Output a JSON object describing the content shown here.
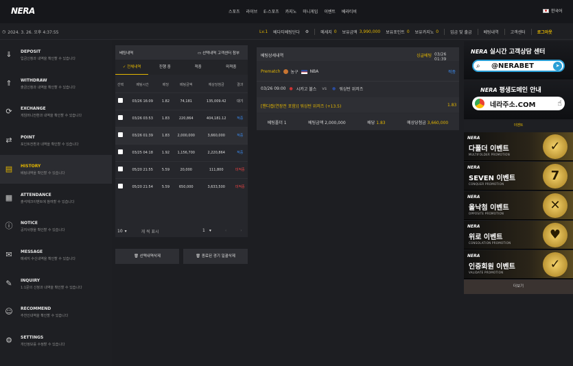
{
  "brand": {
    "logo": "NERA"
  },
  "nav": [
    "스포츠",
    "라이브",
    "E-스포츠",
    "카지노",
    "미니게임",
    "이벤트",
    "베라티비"
  ],
  "lang": "한국어",
  "clock": "2024. 3. 26. 오후 4:37:55",
  "info": {
    "level": "Lv.1",
    "user": "베다티베팅단다",
    "notice_label": "메세지",
    "notice_count": "0",
    "balance_label": "보유금액",
    "balance": "3,990,000",
    "points_label": "보유포인트",
    "points": "0",
    "casino_label": "보유카지노",
    "casino": "0",
    "deposit": "입금 및 출금",
    "history": "베팅내역",
    "cs": "고객센터",
    "logout": "로그아웃"
  },
  "sidebar": [
    {
      "icon": "deposit-icon",
      "glyph": "⇓",
      "title": "DEPOSIT",
      "desc": "입금신청과 내역을 확인할 수 있습니다"
    },
    {
      "icon": "withdraw-icon",
      "glyph": "⇑",
      "title": "WITHDRAW",
      "desc": "출금신청과 내역을 확인할 수 있습니다"
    },
    {
      "icon": "exchange-icon",
      "glyph": "⟳",
      "title": "EXCHANGE",
      "desc": "게임머니전환과 내역을 확인할 수 있습니다"
    },
    {
      "icon": "point-icon",
      "glyph": "⇄",
      "title": "POINT",
      "desc": "포인트전환과 내역을 확인할 수 있습니다"
    },
    {
      "icon": "history-icon",
      "glyph": "▤",
      "title": "HISTORY",
      "desc": "베팅내역을 확인할 수 있습니다"
    },
    {
      "icon": "attendance-icon",
      "glyph": "▦",
      "title": "ATTENDANCE",
      "desc": "출석체크이벤트에 참여할 수 있습니다"
    },
    {
      "icon": "notice-icon",
      "glyph": "ⓘ",
      "title": "NOTICE",
      "desc": "공지사항을 확인할 수 있습니다"
    },
    {
      "icon": "message-icon",
      "glyph": "✉",
      "title": "MESSAGE",
      "desc": "메세지 수신내역을 확인할 수 있습니다"
    },
    {
      "icon": "inquiry-icon",
      "glyph": "✎",
      "title": "INQUIRY",
      "desc": "1:1문의 신청과 내역을 확인할 수 있습니다"
    },
    {
      "icon": "recommend-icon",
      "glyph": "☺",
      "title": "RECOMMEND",
      "desc": "추천인내역을 확인할 수 있습니다"
    },
    {
      "icon": "settings-icon",
      "glyph": "⚙",
      "title": "SETTINGS",
      "desc": "개인정보를 수정할 수 있습니다"
    }
  ],
  "betlist": {
    "title": "베팅내역",
    "attach": "선택내역 고객센터 첨부",
    "tabs": [
      "전체내역",
      "진행 중",
      "적중",
      "미적중"
    ],
    "columns": [
      "선택",
      "베팅시간",
      "배당",
      "베팅금액",
      "예상당첨금",
      "결과"
    ],
    "rows": [
      {
        "time": "03/26 16:09",
        "odds": "1.82",
        "amount": "74,181",
        "win": "135,009.42",
        "result": "대기",
        "cls": "st-gray"
      },
      {
        "time": "03/26 03:53",
        "odds": "1.83",
        "amount": "220,864",
        "win": "404,181.12",
        "result": "적중",
        "cls": "st-blue"
      },
      {
        "time": "03/26 01:39",
        "odds": "1.83",
        "amount": "2,000,000",
        "win": "3,660,000",
        "result": "적중",
        "cls": "st-blue"
      },
      {
        "time": "03/25 04:18",
        "odds": "1.92",
        "amount": "1,156,700",
        "win": "2,220,864",
        "result": "적중",
        "cls": "st-blue"
      },
      {
        "time": "05/20 21:55",
        "odds": "5.59",
        "amount": "20,000",
        "win": "111,800",
        "result": "미적중",
        "cls": "st-red"
      },
      {
        "time": "05/20 21:54",
        "odds": "5.59",
        "amount": "650,000",
        "win": "3,633,500",
        "result": "미적중",
        "cls": "st-red"
      }
    ],
    "delete_selected": "선택내역삭제",
    "delete_finished": "종료된 경기 일괄삭제",
    "per_page": "10",
    "per_page_label": "개 씩 표시",
    "page": "1"
  },
  "detail": {
    "title": "베팅상세내역",
    "type": "싱글베팅",
    "time": "03/26 01:39",
    "category": "Prematch",
    "sport": "농구",
    "league": "NBA",
    "status": "적중",
    "match_time": "03/26 09:00",
    "home": "시카고 불스",
    "vs": "vs",
    "away": "워싱턴 위저즈",
    "pick": "[핸디캡(연장전 포함)] 워싱턴 위저즈 (+13.5)",
    "pick_odds": "1.83",
    "sum_count_label": "베팅폴더",
    "sum_count": "1",
    "sum_amount_label": "베팅금액",
    "sum_amount": "2,000,000",
    "sum_odds_label": "배당",
    "sum_odds": "1.83",
    "sum_win_label": "예상당첨금",
    "sum_win": "3,660,000"
  },
  "ads": {
    "cs_title": "실시간 고객상담 센터",
    "cs_handle": "@NERABET",
    "domain_title": "평생도메인 안내",
    "domain_url": "네라주소.COM",
    "events_label": "이벤트",
    "more": "더보기",
    "promos": [
      {
        "title": "다폴더 이벤트",
        "sub": "MULTIFOLDER PROMOTION",
        "glyph": "✓"
      },
      {
        "title": "SEVEN 이벤트",
        "sub": "CONQUER PROMOTION",
        "glyph": "7"
      },
      {
        "title": "올낙첨 이벤트",
        "sub": "OPPOSITE PROMOTION",
        "glyph": "✕"
      },
      {
        "title": "위로 이벤트",
        "sub": "CONSOLATION PROMOTION",
        "glyph": "♥"
      },
      {
        "title": "인증회원 이벤트",
        "sub": "VALIDATE PROMOTION",
        "glyph": "✓"
      }
    ]
  }
}
